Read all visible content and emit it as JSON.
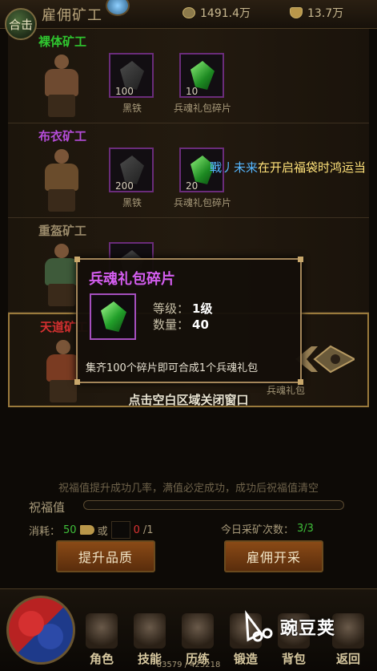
{
  "header": {
    "combo_label": "合击",
    "title": "雇佣矿工",
    "gold": "1491.4万",
    "ingot": "13.7万"
  },
  "workers": [
    {
      "name": "裸体矿工",
      "name_color": "#2fc52f",
      "materials": [
        {
          "qty": "100",
          "label": "黑铁"
        },
        {
          "qty": "10",
          "label": "兵魂礼包碎片"
        }
      ]
    },
    {
      "name": "布衣矿工",
      "name_color": "#b44cd8",
      "materials": [
        {
          "qty": "200",
          "label": "黑铁"
        },
        {
          "qty": "20",
          "label": "兵魂礼包碎片"
        }
      ]
    },
    {
      "name": "重盔矿工",
      "name_color": "#9a8a6a",
      "materials": []
    },
    {
      "name": "天道矿工",
      "name_color": "#d43030",
      "materials": [
        {
          "qty": "",
          "label": "兵魂礼包"
        }
      ]
    }
  ],
  "broadcast": {
    "player": "戰丿未来",
    "message": "在开启福袋时鸿运当"
  },
  "tooltip": {
    "title": "兵魂礼包碎片",
    "level_label": "等级：",
    "level_value": "1级",
    "qty_label": "数量：",
    "qty_value": "40",
    "description": "集齐100个碎片即可合成1个兵魂礼包"
  },
  "close_hint": "点击空白区域关闭窗口",
  "bless": {
    "description": "祝福值提升成功几率，满值必定成功，成功后祝福值清空",
    "label": "祝福值",
    "progress": 0
  },
  "cost": {
    "label": "消耗：",
    "amount": "50",
    "or": "或",
    "fraction_have": "0",
    "fraction_need": "/1"
  },
  "daily": {
    "label": "今日采矿次数：",
    "value": "3/3"
  },
  "buttons": {
    "upgrade": "提升品质",
    "hire": "雇佣开采"
  },
  "nav": {
    "role": "角色",
    "skill": "技能",
    "train": "历练",
    "forge": "锻造",
    "bag": "背包",
    "back": "返回"
  },
  "exp": "83579 / 425218",
  "watermark": "豌豆荚",
  "colors": {
    "accent_gold": "#b9974a",
    "purple_rarity": "#d45ef0",
    "green_text": "#3fbf3a",
    "broadcast_player": "#56b7ff",
    "broadcast_msg": "#ffe27a"
  },
  "icons": {
    "gold": "coin-icon",
    "ingot": "ingot-icon",
    "cost": "horn-icon"
  }
}
